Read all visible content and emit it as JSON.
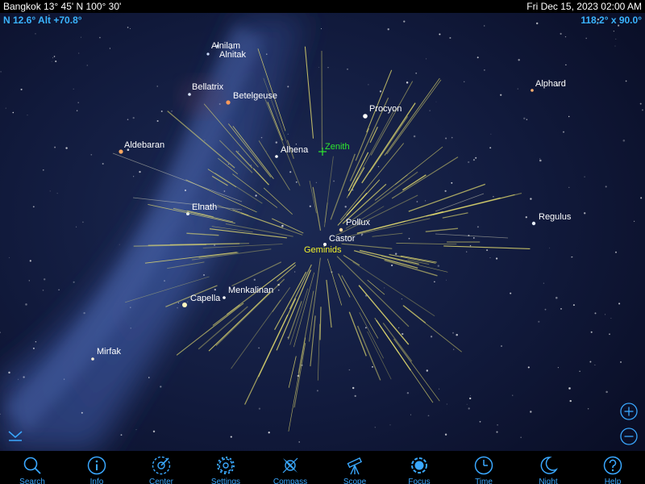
{
  "status_bar": {
    "location": "Bangkok  13° 45' N 100° 30'",
    "datetime": "Fri Dec 15, 2023   02:00 AM"
  },
  "readouts": {
    "pointing": "N 12.6° Alt +70.8°",
    "field_of_view": "118.2° x 90.0°"
  },
  "sky_labels": {
    "alnilam": "Alnilam",
    "alnitak": "Alnitak",
    "bellatrix": "Bellatrix",
    "betelgeuse": "Betelgeuse",
    "procyon": "Procyon",
    "alphard": "Alphard",
    "aldebaran": "Aldebaran",
    "alhena": "Alhena",
    "zenith": "Zenith",
    "elnath": "Elnath",
    "pollux": "Pollux",
    "castor": "Castor",
    "geminids": "Geminids",
    "regulus": "Regulus",
    "capella": "Capella",
    "menkalinan": "Menkalinan",
    "mirfak": "Mirfak"
  },
  "toolbar": {
    "search": "Search",
    "info": "Info",
    "center": "Center",
    "settings": "Settings",
    "compass": "Compass",
    "scope": "Scope",
    "focus": "Focus",
    "time": "Time",
    "night": "Night",
    "help": "Help"
  },
  "colors": {
    "accent": "#3aa8ff",
    "zenith": "#2ee82e",
    "meteor_trail": "#e8e070",
    "shower_label": "#f2f22a"
  }
}
